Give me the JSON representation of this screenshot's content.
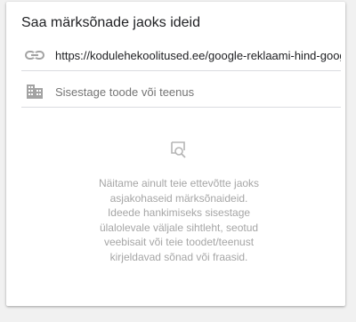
{
  "panel": {
    "title": "Saa märksõnade jaoks ideid"
  },
  "url_field": {
    "icon": "link-icon",
    "value": "https://kodulehekoolitused.ee/google-reklaami-hind-google-ads"
  },
  "product_field": {
    "icon": "building-icon",
    "placeholder": "Sisestage toode või teenus"
  },
  "empty_state": {
    "icon": "search-document-icon",
    "lines": [
      "Näitame ainult teie ettevõtte jaoks",
      "asjakohaseid märksõnaideid.",
      "Ideede hankimiseks sisestage",
      "ülalolevale väljale sihtleht, seotud",
      "veebisait või teie toodet/teenust",
      "kirjeldavad sõnad või fraasid."
    ]
  },
  "colors": {
    "title_text": "#202124",
    "icon": "#a3a3a3",
    "divider": "#dadce0",
    "hint_text": "#a6a6a6"
  }
}
